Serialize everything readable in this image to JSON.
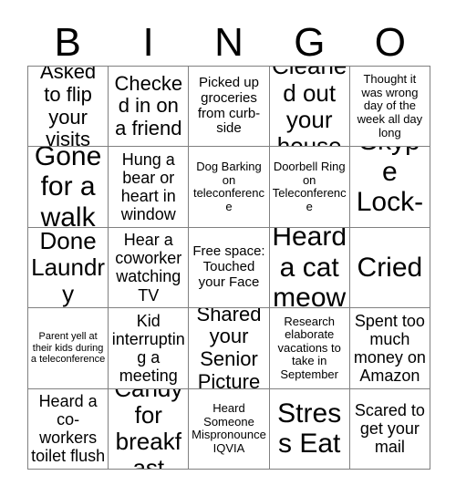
{
  "card": {
    "title_letters": [
      "B",
      "I",
      "N",
      "G",
      "O"
    ],
    "columns": 5,
    "rows": 5,
    "border_color": "#808080",
    "text_color": "#000000",
    "background_color": "#ffffff"
  },
  "squares": [
    {
      "text": "Asked to flip your visits",
      "size": "lg"
    },
    {
      "text": "Checked in on a friend",
      "size": "lg"
    },
    {
      "text": "Picked up groceries from curb-side",
      "size": "sm"
    },
    {
      "text": "Cleaned out your house",
      "size": "xl"
    },
    {
      "text": "Thought it was wrong day of the week all day long",
      "size": "xs"
    },
    {
      "text": "Gone for a walk",
      "size": "xxl"
    },
    {
      "text": "Hung a bear or heart in window",
      "size": "md"
    },
    {
      "text": "Dog Barking on teleconference",
      "size": "xs"
    },
    {
      "text": "Doorbell Ring on Teleconference",
      "size": "xs"
    },
    {
      "text": "Skype Lock-up",
      "size": "xxl"
    },
    {
      "text": "Done Laundry",
      "size": "xl"
    },
    {
      "text": "Hear a coworker watching TV",
      "size": "md"
    },
    {
      "text": "Free space: Touched your Face",
      "size": "sm"
    },
    {
      "text": "Heard a cat meow",
      "size": "xxl"
    },
    {
      "text": "Cried",
      "size": "xxl"
    },
    {
      "text": "Parent yell at their kids during a teleconference",
      "size": "xxs"
    },
    {
      "text": "Kid interrupting a meeting",
      "size": "md"
    },
    {
      "text": "Shared your Senior Picture",
      "size": "lg"
    },
    {
      "text": "Research elaborate vacations to take in September",
      "size": "xs"
    },
    {
      "text": "Spent too much money on Amazon",
      "size": "md"
    },
    {
      "text": "Heard a co-workers toilet flush",
      "size": "md"
    },
    {
      "text": "Candy for breakfast",
      "size": "xl"
    },
    {
      "text": "Heard Someone Mispronounce IQVIA",
      "size": "xs"
    },
    {
      "text": "Stress Eat",
      "size": "xxl"
    },
    {
      "text": "Scared to get your mail",
      "size": "md"
    }
  ]
}
